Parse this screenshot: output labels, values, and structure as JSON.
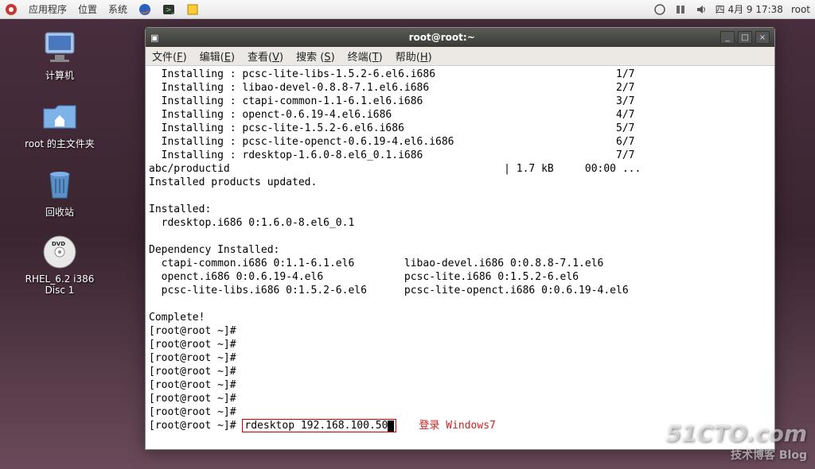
{
  "panel": {
    "apps": "应用程序",
    "places": "位置",
    "system": "系统",
    "datetime": "四  4月  9 17:38",
    "user": "root"
  },
  "desktop": {
    "computer": "计算机",
    "home": "root 的主文件夹",
    "trash": "回收站",
    "disc": "RHEL_6.2 i386 Disc 1"
  },
  "terminal": {
    "title": "root@root:~",
    "menu": {
      "file": "文件(F)",
      "edit": "编辑(E)",
      "view": "查看(V)",
      "search": "搜索 (S)",
      "terminal": "终端(T)",
      "help": "帮助(H)"
    },
    "lines": [
      "  Installing : pcsc-lite-libs-1.5.2-6.el6.i686                             1/7",
      "  Installing : libao-devel-0.8.8-7.1.el6.i686                              2/7",
      "  Installing : ctapi-common-1.1-6.1.el6.i686                               3/7",
      "  Installing : openct-0.6.19-4.el6.i686                                    4/7",
      "  Installing : pcsc-lite-1.5.2-6.el6.i686                                  5/7",
      "  Installing : pcsc-lite-openct-0.6.19-4.el6.i686                          6/7",
      "  Installing : rdesktop-1.6.0-8.el6_0.1.i686                               7/7",
      "abc/productid                                            | 1.7 kB     00:00 ...",
      "Installed products updated.",
      "",
      "Installed:",
      "  rdesktop.i686 0:1.6.0-8.el6_0.1",
      "",
      "Dependency Installed:",
      "  ctapi-common.i686 0:1.1-6.1.el6        libao-devel.i686 0:0.8.8-7.1.el6",
      "  openct.i686 0:0.6.19-4.el6             pcsc-lite.i686 0:1.5.2-6.el6",
      "  pcsc-lite-libs.i686 0:1.5.2-6.el6      pcsc-lite-openct.i686 0:0.6.19-4.el6",
      "",
      "Complete!",
      "[root@root ~]#",
      "[root@root ~]#",
      "[root@root ~]#",
      "[root@root ~]#",
      "[root@root ~]#",
      "[root@root ~]#",
      "[root@root ~]#"
    ],
    "prompt": "[root@root ~]# ",
    "cmd": "rdesktop 192.168.100.50",
    "note": "登录 Windows7"
  },
  "watermark": {
    "main": "51CTO.com",
    "sub": "技术博客 Blog"
  }
}
